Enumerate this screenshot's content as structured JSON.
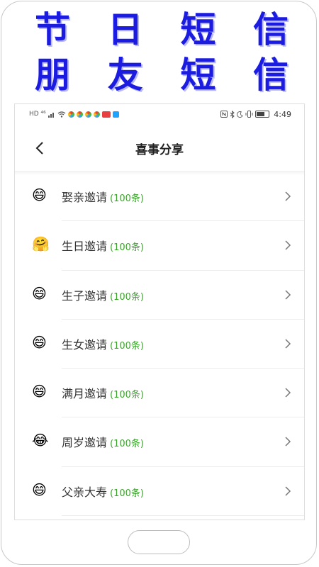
{
  "banner": {
    "line1": [
      "节",
      "日",
      "短",
      "信"
    ],
    "line2": [
      "朋",
      "友",
      "短",
      "信"
    ]
  },
  "status_bar": {
    "left_text": "HD ⁴⁶",
    "time": "4:49"
  },
  "header": {
    "title": "喜事分享"
  },
  "list": [
    {
      "emoji": "😄",
      "label": "娶亲邀请",
      "count": "(100条)"
    },
    {
      "emoji": "🤗",
      "label": "生日邀请",
      "count": "(100条)"
    },
    {
      "emoji": "😄",
      "label": "生子邀请",
      "count": "(100条)"
    },
    {
      "emoji": "😄",
      "label": "生女邀请",
      "count": "(100条)"
    },
    {
      "emoji": "😄",
      "label": "满月邀请",
      "count": "(100条)"
    },
    {
      "emoji": "😂",
      "label": "周岁邀请",
      "count": "(100条)"
    },
    {
      "emoji": "😄",
      "label": "父亲大寿",
      "count": "(100条)"
    }
  ],
  "colors": {
    "banner_text": "#1c1ce0",
    "count_green": "#3aa52a"
  }
}
